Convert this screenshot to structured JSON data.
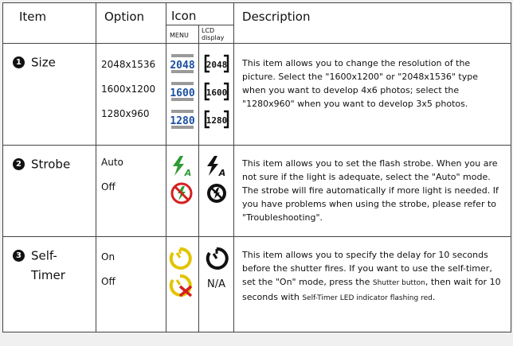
{
  "header": {
    "item": "Item",
    "option": "Option",
    "icon": "Icon",
    "menu": "MENU",
    "lcd_line1": "LCD",
    "lcd_line2": "display",
    "description": "Description"
  },
  "rows": [
    {
      "number": "1",
      "label": "Size",
      "options": [
        "2048x1536",
        "1600x1200",
        "1280x960"
      ],
      "menu_icons": [
        "2048",
        "1600",
        "1280"
      ],
      "lcd_icons": [
        "2048",
        "1600",
        "1280"
      ],
      "description": "This item allows you to change the resolution of the picture. Select the \"1600x1200\" or \"2048x1536\" type when you want to develop 4x6 photos; select the \"1280x960\" when you want to develop 3x5 photos."
    },
    {
      "number": "2",
      "label": "Strobe",
      "options": [
        "Auto",
        "Off"
      ],
      "menu_icons": [
        "flash-auto-icon",
        "flash-off-icon"
      ],
      "lcd_icons": [
        "flash-auto-icon",
        "flash-off-icon"
      ],
      "description": "This item allows you to set the flash strobe. When you are not sure if the light is adequate, select the \"Auto\" mode. The strobe will fire automatically if more light is needed. If you have problems when using the strobe, please refer to \"Troubleshooting\"."
    },
    {
      "number": "3",
      "label_line1": "Self-",
      "label_line2": "Timer",
      "options": [
        "On",
        "Off"
      ],
      "menu_icons": [
        "timer-on-icon",
        "timer-off-icon"
      ],
      "lcd_icons": [
        "timer-on-icon"
      ],
      "lcd_na": "N/A",
      "desc_part1": "This item allows you to specify the delay for 10 seconds before the shutter fires. If you want to use the self-timer, set the \"On\" mode, press the",
      "desc_small1": "Shutter button",
      "desc_part2": ", then wait for 10 seconds with",
      "desc_small2": "Self-Timer LED indicator flashing red",
      "desc_part3": "."
    }
  ],
  "colors": {
    "menu_icon_blue": "#1a4fa0",
    "flash_green": "#2e9b34",
    "no_red": "#d42020",
    "timer_yellow": "#e3c400"
  }
}
